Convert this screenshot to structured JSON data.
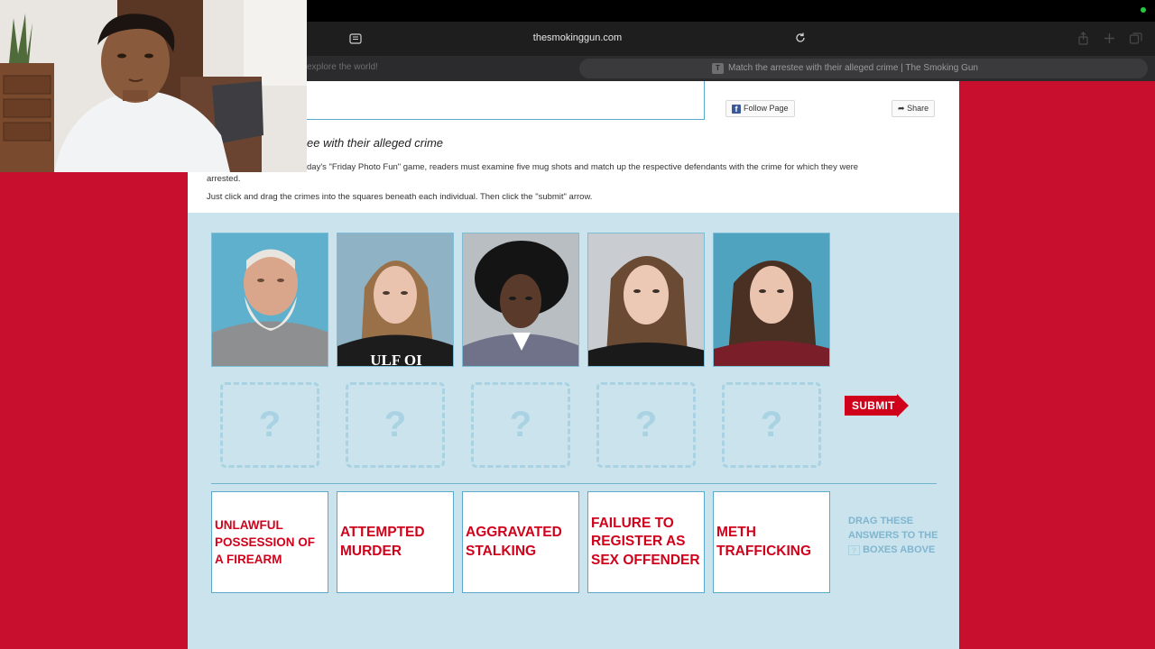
{
  "browser": {
    "url": "thesmokinggun.com",
    "left_tab_title": "explore the world!",
    "active_tab_favicon": "T",
    "active_tab_title": "Match the arrestee with their alleged crime | The Smoking Gun"
  },
  "social": {
    "follow_label": "Follow Page",
    "share_label": "Share"
  },
  "article": {
    "headline": "ee with their alleged crime",
    "intro_line1": "day's \"Friday Photo Fun\" game, readers must examine five mug shots and match up the respective defendants with the crime for which they were",
    "intro_line2": "arrested.",
    "instructions": "Just click and drag the crimes into the squares beneath each individual. Then click the \"submit\" arrow."
  },
  "game": {
    "drop_placeholder": "?",
    "submit_label": "SUBMIT",
    "crimes": [
      "UNLAWFUL POSSESSION OF A FIREARM",
      "ATTEMPTED MURDER",
      "AGGRAVATED STALKING",
      "FAILURE TO REGISTER AS SEX OFFENDER",
      "METH TRAFFICKING"
    ],
    "drag_note_1": "DRAG THESE ANSWERS TO THE",
    "drag_note_icon": "?",
    "drag_note_2": "BOXES ABOVE",
    "shirt_text": "ULF OI"
  },
  "colors": {
    "page_background": "#c8102e",
    "game_background": "#cbe3ec",
    "crime_text": "#d0021b",
    "drop_border": "#a9d2e3"
  }
}
